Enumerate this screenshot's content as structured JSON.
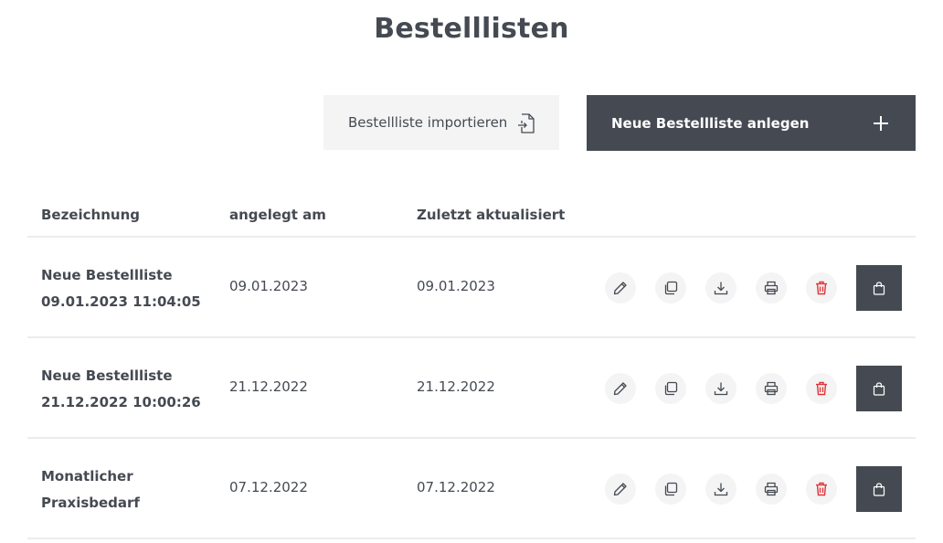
{
  "page": {
    "title": "Bestelllisten"
  },
  "actions": {
    "import_label": "Bestellliste importieren",
    "new_label": "Neue Bestellliste anlegen"
  },
  "table": {
    "headers": [
      "Bezeichnung",
      "angelegt am",
      "Zuletzt aktualisiert"
    ],
    "rows": [
      {
        "name_line1": "Neue Bestellliste",
        "name_line2": "09.01.2023 11:04:05",
        "created": "09.01.2023",
        "updated": "09.01.2023"
      },
      {
        "name_line1": "Neue Bestellliste",
        "name_line2": "21.12.2022 10:00:26",
        "created": "21.12.2022",
        "updated": "21.12.2022"
      },
      {
        "name_line1": "Monatlicher",
        "name_line2": "Praxisbedarf",
        "created": "07.12.2022",
        "updated": "07.12.2022"
      }
    ]
  },
  "row_actions": [
    "pencil-icon",
    "copy-icon",
    "download-icon",
    "printer-icon",
    "trash-icon",
    "shopping-bag-icon"
  ],
  "colors": {
    "primary": "#454a52",
    "light_bg": "#f4f4f4",
    "danger": "#e0353b",
    "divider": "#ececec"
  }
}
